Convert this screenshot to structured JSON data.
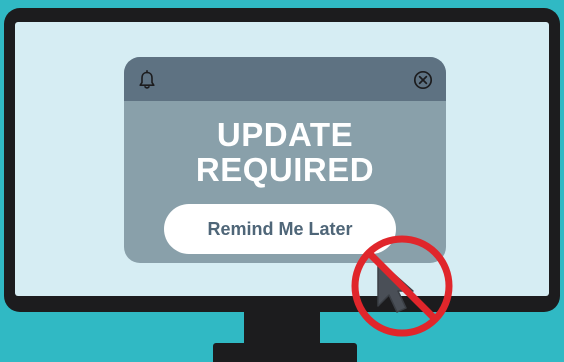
{
  "popup": {
    "title_line1": "UPDATE",
    "title_line2": "REQUIRED",
    "button_label": "Remind Me Later"
  },
  "icons": {
    "header_left": "bell-icon",
    "header_right": "close-icon",
    "overlay": "prohibited-cursor-icon"
  },
  "colors": {
    "background": "#30b9c4",
    "monitor": "#1c1c1e",
    "screen": "#d6edf3",
    "popup_body": "#89a0aa",
    "popup_header": "#5e7282",
    "button_text": "#4f6678",
    "prohibition_red": "#e0262b"
  }
}
